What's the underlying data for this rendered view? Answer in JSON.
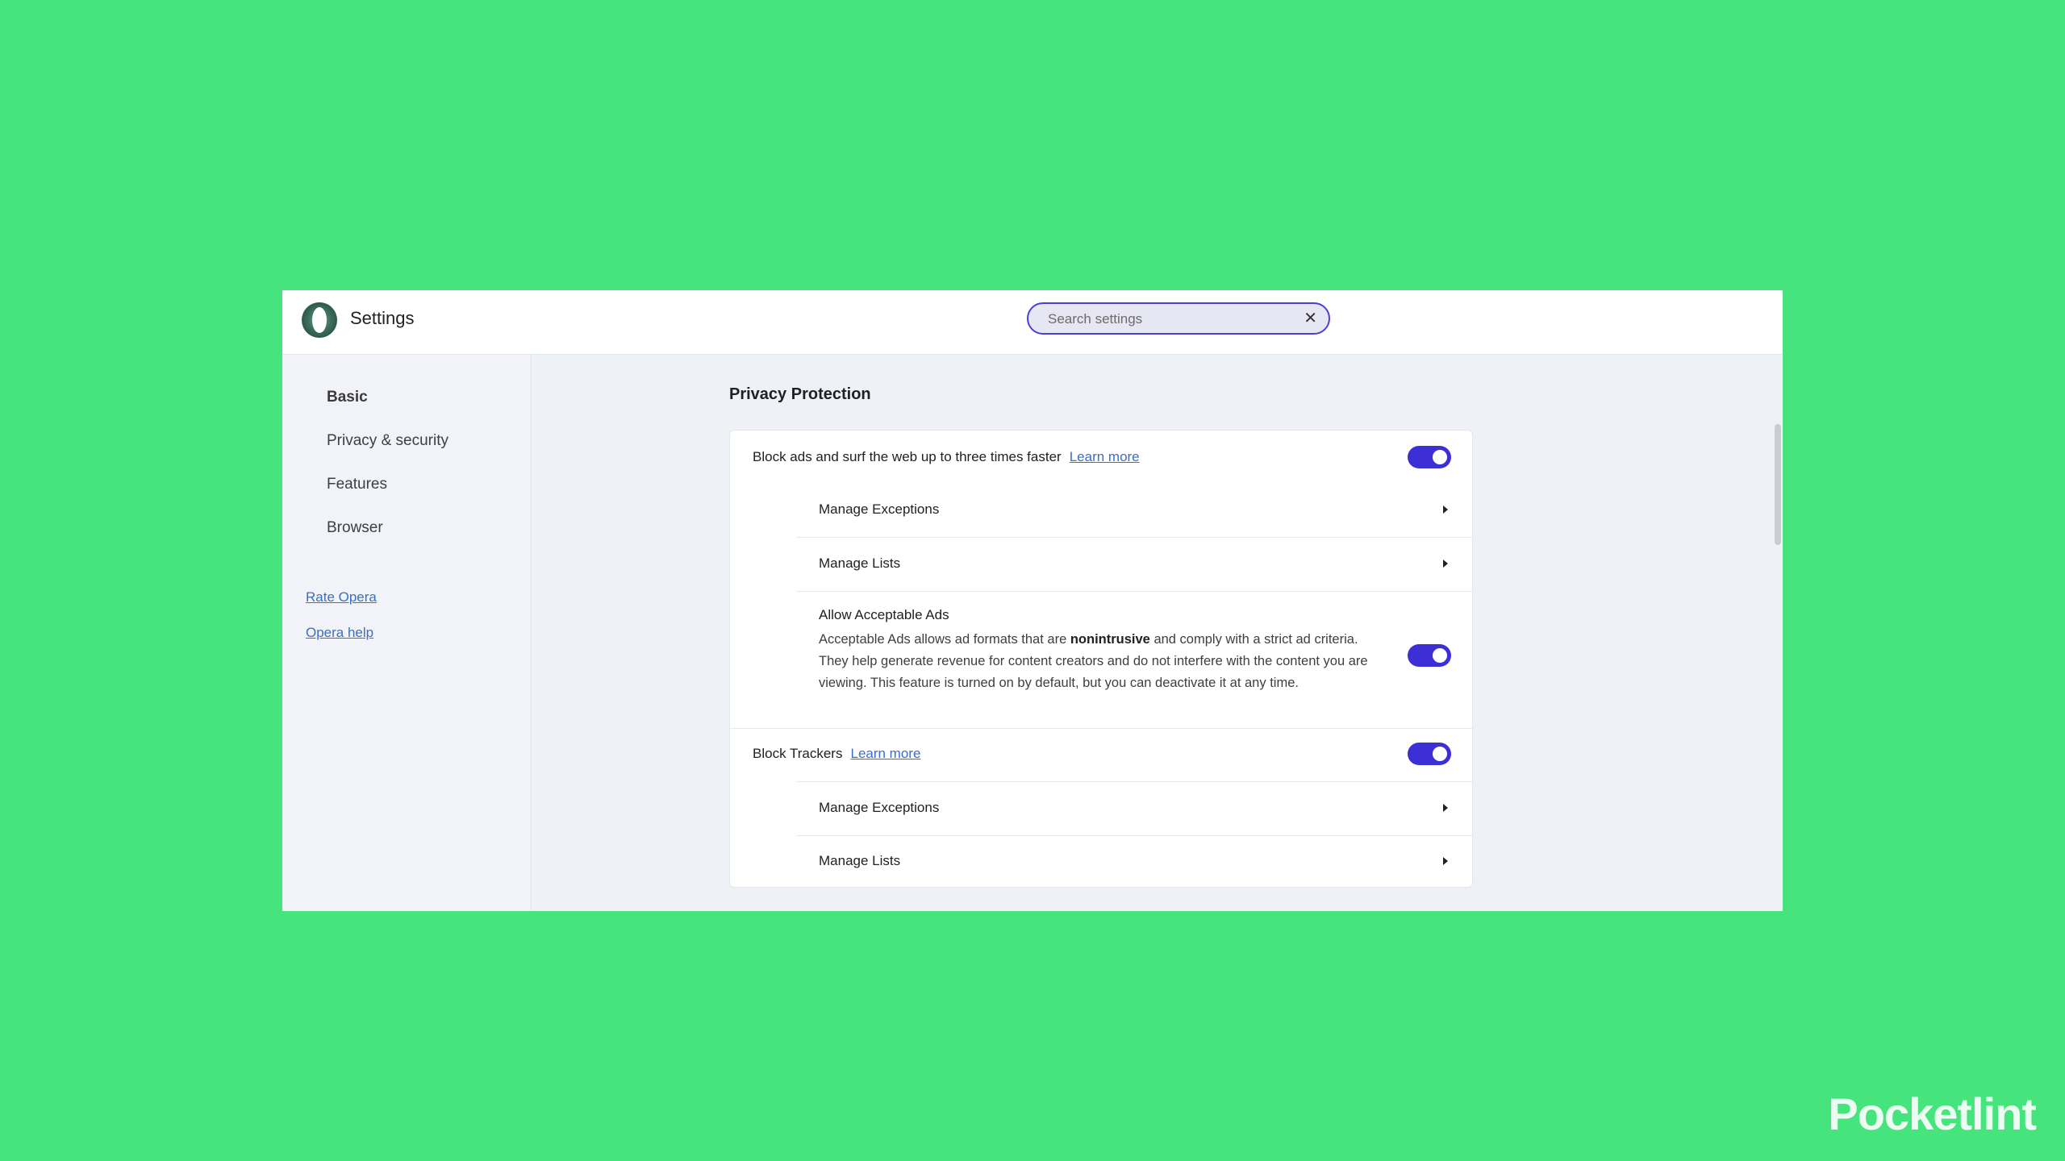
{
  "app": {
    "title": "Settings"
  },
  "search": {
    "placeholder": "Search settings",
    "clear_icon": "close-icon"
  },
  "sidebar": {
    "items": [
      {
        "label": "Basic",
        "active": true
      },
      {
        "label": "Privacy & security"
      },
      {
        "label": "Features"
      },
      {
        "label": "Browser"
      }
    ],
    "links": [
      {
        "label": "Rate Opera"
      },
      {
        "label": "Opera help"
      }
    ]
  },
  "main": {
    "section_title": "Privacy Protection",
    "block_ads": {
      "label": "Block ads and surf the web up to three times faster",
      "learn_more": "Learn more",
      "enabled": true,
      "manage_exceptions": "Manage Exceptions",
      "manage_lists": "Manage Lists"
    },
    "acceptable_ads": {
      "title": "Allow Acceptable Ads",
      "desc_before": "Acceptable Ads allows ad formats that are ",
      "desc_bold": "nonintrusive",
      "desc_after": " and comply with a strict ad criteria. They help generate revenue for content creators and do not interfere with the content you are viewing. This feature is turned on by default, but you can deactivate it at any time.",
      "enabled": true
    },
    "block_trackers": {
      "label": "Block Trackers",
      "learn_more": "Learn more",
      "enabled": true,
      "manage_exceptions": "Manage Exceptions",
      "manage_lists": "Manage Lists"
    }
  },
  "colors": {
    "background": "#45e47c",
    "accent": "#3d2fd6",
    "link": "#3b6fc4"
  },
  "watermark": "Pocketlint"
}
